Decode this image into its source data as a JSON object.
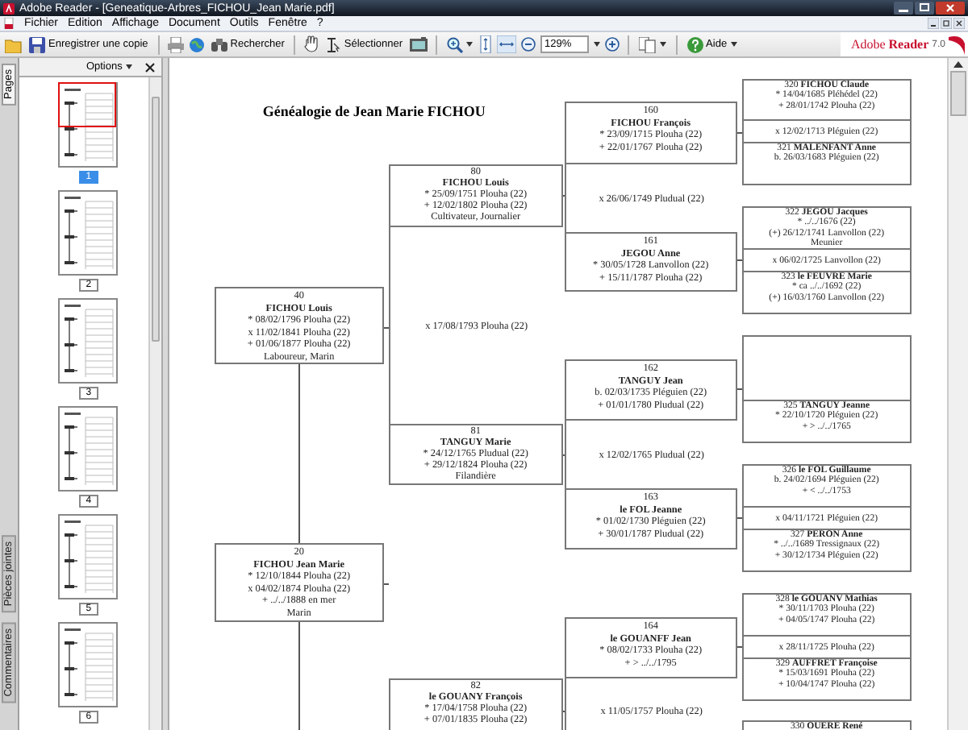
{
  "window": {
    "title": "Adobe Reader - [Geneatique-Arbres_FICHOU_Jean Marie.pdf]"
  },
  "menu": [
    "Fichier",
    "Edition",
    "Affichage",
    "Document",
    "Outils",
    "Fenêtre",
    "?"
  ],
  "toolbar": {
    "save_label": "Enregistrer une copie",
    "search_label": "Rechercher",
    "select_label": "Sélectionner",
    "zoom_value": "129%",
    "help_label": "Aide"
  },
  "brand": {
    "name": "Adobe",
    "product": "Reader",
    "version": "7.0"
  },
  "side_panel": {
    "options_label": "Options",
    "tabs": [
      {
        "label": "Pages",
        "selected": true
      },
      {
        "label": "Pièces jointes",
        "selected": false
      },
      {
        "label": "Commentaires",
        "selected": false
      }
    ],
    "thumbnails": [
      {
        "label": "1",
        "selected": true
      },
      {
        "label": "2",
        "selected": false
      },
      {
        "label": "3",
        "selected": false
      },
      {
        "label": "4",
        "selected": false
      },
      {
        "label": "5",
        "selected": false
      },
      {
        "label": "6",
        "selected": false
      }
    ]
  },
  "document": {
    "title": "Généalogie de Jean Marie FICHOU",
    "persons": [
      {
        "number": "40",
        "name": "FICHOU Louis",
        "details": [
          "* 08/02/1796 Plouha (22)",
          "x 11/02/1841 Plouha (22)",
          "+ 01/06/1877 Plouha (22)",
          "Laboureur, Marin"
        ]
      },
      {
        "number": "20",
        "name": "FICHOU Jean Marie",
        "details": [
          "* 12/10/1844 Plouha (22)",
          "x 04/02/1874 Plouha (22)",
          "+ ../../1888 en mer",
          "Marin"
        ]
      },
      {
        "number": "80",
        "name": "FICHOU Louis",
        "details": [
          "* 25/09/1751 Plouha (22)",
          "+ 12/02/1802 Plouha (22)",
          "Cultivateur, Journalier"
        ]
      },
      {
        "number": "81",
        "name": "TANGUY Marie",
        "details": [
          "* 24/12/1765 Pludual (22)",
          "+ 29/12/1824 Plouha (22)",
          "Filandière"
        ]
      },
      {
        "number": "82",
        "name": "le GOUANY François",
        "details": [
          "* 17/04/1758 Plouha (22)",
          "+ 07/01/1835 Plouha (22)"
        ]
      },
      {
        "number": "160",
        "name": "FICHOU François",
        "details": [
          "* 23/09/1715 Plouha (22)",
          "+ 22/01/1767 Plouha (22)"
        ]
      },
      {
        "number": "161",
        "name": "JEGOU Anne",
        "details": [
          "* 30/05/1728 Lanvollon (22)",
          "+ 15/11/1787 Plouha (22)"
        ]
      },
      {
        "number": "162",
        "name": "TANGUY Jean",
        "details": [
          "b. 02/03/1735 Pléguien (22)",
          "+ 01/01/1780 Pludual (22)"
        ]
      },
      {
        "number": "163",
        "name": "le FOL Jeanne",
        "details": [
          "* 01/02/1730 Pléguien (22)",
          "+ 30/01/1787 Pludual (22)"
        ]
      },
      {
        "number": "164",
        "name": "le GOUANFF Jean",
        "details": [
          "* 08/02/1733 Plouha (22)",
          "+ > ../../1795"
        ]
      },
      {
        "heading": "320 **FICHOU Claude**",
        "details": [
          "* 14/04/1685 Pléhédel (22)",
          "+ 28/01/1742 Plouha (22)"
        ]
      },
      {
        "heading": "321 **MALENFANT Anne**",
        "details": [
          "b. 26/03/1683 Pléguien (22)"
        ]
      },
      {
        "heading": "322 **JEGOU Jacques**",
        "details": [
          "* ../../1676 (22)",
          "(+) 26/12/1741 Lanvollon (22)",
          "Meunier"
        ]
      },
      {
        "heading": "323 **le FEUVRE Marie**",
        "details": [
          "* ca ../../1692 (22)",
          "(+) 16/03/1760 Lanvollon (22)"
        ]
      },
      {
        "heading": "325 **TANGUY Jeanne**",
        "details": [
          "* 22/10/1720 Pléguien (22)",
          "+ > ../../1765"
        ]
      },
      {
        "heading": "326 **le FOL Guillaume**",
        "details": [
          "b. 24/02/1694 Pléguien (22)",
          "+ < ../../1753"
        ]
      },
      {
        "heading": "327 **PERON Anne**",
        "details": [
          "* ../../1689 Tressignaux (22)",
          "+ 30/12/1734 Pléguien (22)"
        ]
      },
      {
        "heading": "328 **le GOUANV Mathias**",
        "details": [
          "* 30/11/1703 Plouha (22)",
          "+ 04/05/1747 Plouha (22)"
        ]
      },
      {
        "heading": "329 **AUFFRET Françoise**",
        "details": [
          "* 15/03/1691 Plouha (22)",
          "+ 10/04/1747 Plouha (22)"
        ]
      },
      {
        "heading": "330 **OUERE René**"
      }
    ],
    "marriages": [
      "x 17/08/1793 Plouha (22)",
      "x 26/06/1749 Pludual (22)",
      "x 12/02/1765 Pludual (22)",
      "x 11/05/1757 Plouha (22)",
      "x 12/02/1713 Pléguien (22)",
      "x 06/02/1725 Lanvollon (22)",
      "x 04/11/1721 Pléguien (22)",
      "x 28/11/1725 Plouha (22)"
    ]
  }
}
